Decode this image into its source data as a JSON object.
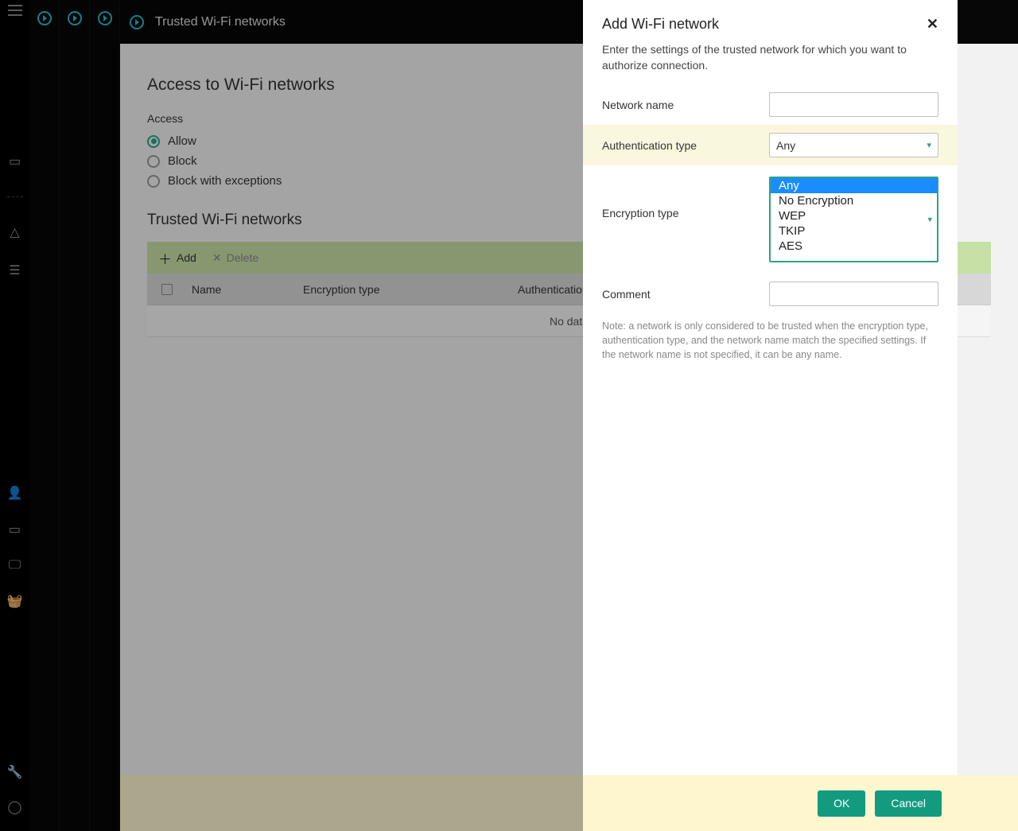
{
  "header": {
    "title": "Trusted Wi-Fi networks"
  },
  "page": {
    "heading": "Access to Wi-Fi networks",
    "access_label": "Access",
    "radios": {
      "allow": "Allow",
      "block": "Block",
      "block_exceptions": "Block with exceptions"
    },
    "trusted_heading": "Trusted Wi-Fi networks",
    "toolbar": {
      "add": "Add",
      "delete": "Delete"
    },
    "table": {
      "col_name": "Name",
      "col_enc": "Encryption type",
      "col_auth": "Authentication type",
      "empty": "No data"
    }
  },
  "panel": {
    "title": "Add Wi-Fi network",
    "subtitle": "Enter the settings of the trusted network for which you want to authorize connection.",
    "labels": {
      "network_name": "Network name",
      "auth_type": "Authentication type",
      "enc_type": "Encryption type",
      "comment": "Comment"
    },
    "auth_value": "Any",
    "enc_options": [
      "Any",
      "No Encryption",
      "WEP",
      "TKIP",
      "AES"
    ],
    "enc_selected_index": 0,
    "note": "Note: a network is only considered to be trusted when the encryption type, authentication type, and the network name match the specified settings. If the network name is not specified, it can be any name.",
    "buttons": {
      "ok": "OK",
      "cancel": "Cancel"
    }
  }
}
